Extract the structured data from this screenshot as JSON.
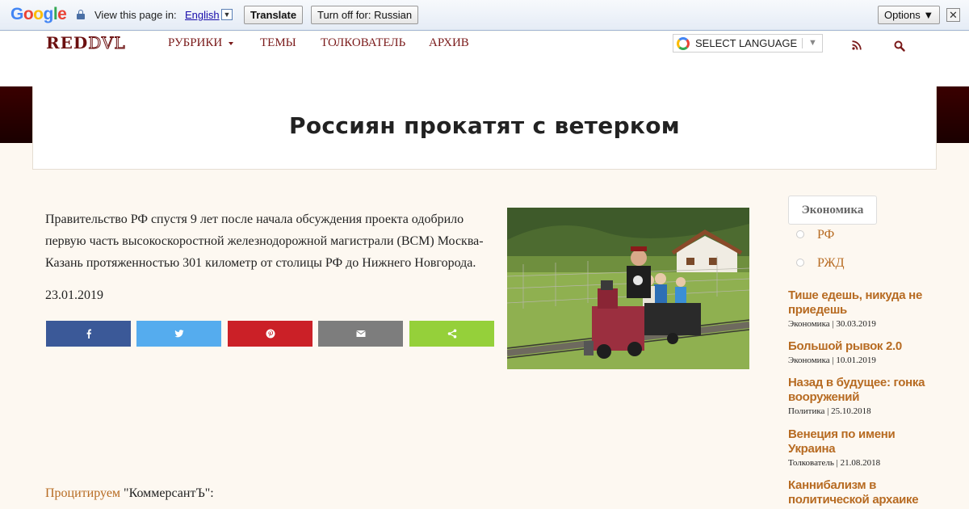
{
  "translate_bar": {
    "logo_letters": [
      "G",
      "o",
      "o",
      "g",
      "l",
      "e"
    ],
    "logo_colors": [
      "#4285f4",
      "#ea4335",
      "#fbbc05",
      "#4285f4",
      "#34a853",
      "#ea4335"
    ],
    "prompt": "View this page in:",
    "language": "English",
    "translate_label": "Translate",
    "turn_off_label": "Turn off for: Russian",
    "options_label": "Options ▼",
    "close_label": "✕"
  },
  "header": {
    "logo_main": "RED",
    "logo_accent": "DVL",
    "nav": [
      {
        "label": "РУБРИКИ",
        "has_caret": true
      },
      {
        "label": "ТЕМЫ"
      },
      {
        "label": "ТОЛКОВАТЕЛЬ"
      },
      {
        "label": "АРХИВ"
      }
    ],
    "select_language": "SELECT LANGUAGE",
    "select_arrow": "▼",
    "accent_color": "#7a1a1a"
  },
  "article": {
    "title": "Россиян прокатят с ветерком",
    "lead": "Правительство РФ спустя 9 лет после начала обсуждения проекта одобрило первую часть высокоскоростной железнодорожной магистрали (ВСМ) Москва-Казань протяженностью 301 километр от столицы РФ до Нижнего Новгорода.",
    "date": "23.01.2019",
    "share_buttons": [
      {
        "name": "facebook",
        "icon": "facebook-icon",
        "color": "#3b5998"
      },
      {
        "name": "twitter",
        "icon": "twitter-icon",
        "color": "#55acee"
      },
      {
        "name": "pinterest",
        "icon": "pinterest-icon",
        "color": "#cb2027"
      },
      {
        "name": "email",
        "icon": "email-icon",
        "color": "#7d7d7d"
      },
      {
        "name": "sharethis",
        "icon": "share-icon",
        "color": "#95d03a"
      }
    ],
    "quote_link": "Процитируем",
    "quote_source": "\"КоммерсантЪ\":"
  },
  "sidebar": {
    "category": "Экономика",
    "tags": [
      "РФ",
      "РЖД"
    ],
    "posts": [
      {
        "title": "Тише едешь, никуда не приедешь",
        "meta": "Экономика | 30.03.2019"
      },
      {
        "title": "Большой рывок 2.0",
        "meta": "Экономика | 10.01.2019"
      },
      {
        "title": "Назад в будущее: гонка вооружений",
        "meta": "Политика | 25.10.2018"
      },
      {
        "title": "Венеция по имени Украина",
        "meta": "Толкователь | 21.08.2018"
      },
      {
        "title": "Каннибализм в политической архаике",
        "meta": ""
      }
    ],
    "link_color": "#b76b22"
  }
}
